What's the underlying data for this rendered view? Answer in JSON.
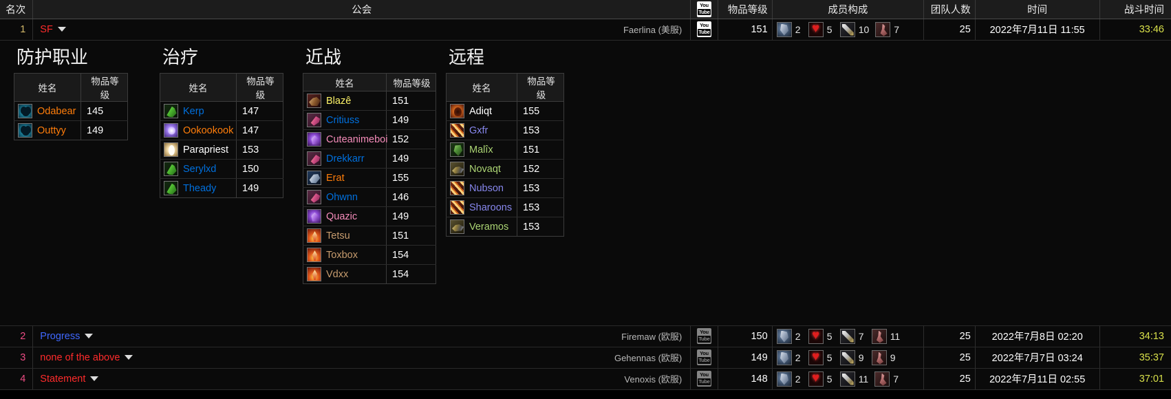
{
  "table": {
    "headers": {
      "rank": "名次",
      "guild": "公会",
      "video": "youtube-icon",
      "ilvl": "物品等级",
      "composition": "成员构成",
      "raid_size": "团队人数",
      "time": "时间",
      "duration": "战斗时间"
    }
  },
  "rows": [
    {
      "rank": "1",
      "guild": "SF",
      "guild_color": "#ff2b2b",
      "realm": "Faerlina (美服)",
      "ilvl": "151",
      "comp": {
        "tanks": "2",
        "healers": "5",
        "melee": "10",
        "ranged": "7"
      },
      "raid_size": "25",
      "time": "2022年7月11日 11:55",
      "duration": "33:46",
      "expanded": true
    },
    {
      "rank": "2",
      "guild": "Progress",
      "guild_color": "#3f68ff",
      "realm": "Firemaw (欧服)",
      "ilvl": "150",
      "comp": {
        "tanks": "2",
        "healers": "5",
        "melee": "7",
        "ranged": "11"
      },
      "raid_size": "25",
      "time": "2022年7月8日 02:20",
      "duration": "34:13",
      "expanded": false
    },
    {
      "rank": "3",
      "guild": "none of the above",
      "guild_color": "#ff2b2b",
      "realm": "Gehennas (欧服)",
      "ilvl": "149",
      "comp": {
        "tanks": "2",
        "healers": "5",
        "melee": "9",
        "ranged": "9"
      },
      "raid_size": "25",
      "time": "2022年7月7日 03:24",
      "duration": "35:37",
      "expanded": false
    },
    {
      "rank": "4",
      "guild": "Statement",
      "guild_color": "#ff2b2b",
      "realm": "Venoxis (欧服)",
      "ilvl": "148",
      "comp": {
        "tanks": "2",
        "healers": "5",
        "melee": "11",
        "ranged": "7"
      },
      "raid_size": "25",
      "time": "2022年7月11日 02:55",
      "duration": "37:01",
      "expanded": false
    }
  ],
  "roster": {
    "col_name": "姓名",
    "col_ilvl": "物品等级",
    "groups": [
      {
        "title": "防护职业",
        "players": [
          {
            "name": "Odabear",
            "ilvl": "145",
            "class": "druid",
            "icon": "bear-form-icon"
          },
          {
            "name": "Outtyy",
            "ilvl": "149",
            "class": "druid",
            "icon": "bear-form-icon"
          }
        ]
      },
      {
        "title": "治疗",
        "players": [
          {
            "name": "Kerp",
            "ilvl": "147",
            "class": "shaman",
            "icon": "restoration-shaman-icon"
          },
          {
            "name": "Ookookook",
            "ilvl": "147",
            "class": "druid",
            "icon": "restoration-druid-icon"
          },
          {
            "name": "Parapriest",
            "ilvl": "153",
            "class": "priest",
            "icon": "holy-priest-icon"
          },
          {
            "name": "Serylxd",
            "ilvl": "150",
            "class": "shaman",
            "icon": "restoration-shaman-icon"
          },
          {
            "name": "Theady",
            "ilvl": "149",
            "class": "shaman",
            "icon": "restoration-shaman-icon"
          }
        ]
      },
      {
        "title": "近战",
        "players": [
          {
            "name": "Blazê",
            "ilvl": "151",
            "class": "rogue",
            "icon": "rogue-icon"
          },
          {
            "name": "Critiuss",
            "ilvl": "149",
            "class": "shaman",
            "icon": "enhancement-shaman-icon"
          },
          {
            "name": "Cuteanimeboi",
            "ilvl": "152",
            "class": "paladin",
            "icon": "retribution-paladin-icon"
          },
          {
            "name": "Drekkarr",
            "ilvl": "149",
            "class": "shaman",
            "icon": "enhancement-shaman-icon"
          },
          {
            "name": "Erat",
            "ilvl": "155",
            "class": "druid",
            "icon": "feral-druid-icon"
          },
          {
            "name": "Ohwnn",
            "ilvl": "146",
            "class": "shaman",
            "icon": "enhancement-shaman-icon"
          },
          {
            "name": "Quazic",
            "ilvl": "149",
            "class": "paladin",
            "icon": "retribution-paladin-icon"
          },
          {
            "name": "Tetsu",
            "ilvl": "151",
            "class": "warrior",
            "icon": "warrior-icon"
          },
          {
            "name": "Toxbox",
            "ilvl": "154",
            "class": "warrior",
            "icon": "warrior-icon"
          },
          {
            "name": "Vdxx",
            "ilvl": "154",
            "class": "warrior",
            "icon": "warrior-icon"
          }
        ]
      },
      {
        "title": "远程",
        "players": [
          {
            "name": "Adiqt",
            "ilvl": "155",
            "class": "priest",
            "icon": "shadow-priest-icon"
          },
          {
            "name": "Gxfr",
            "ilvl": "153",
            "class": "warlock",
            "icon": "warlock-icon"
          },
          {
            "name": "Malîx",
            "ilvl": "151",
            "class": "hunter",
            "icon": "hunter-icon"
          },
          {
            "name": "Novaqt",
            "ilvl": "152",
            "class": "hunter",
            "icon": "marksmanship-hunter-icon"
          },
          {
            "name": "Nubson",
            "ilvl": "153",
            "class": "warlock",
            "icon": "warlock-icon"
          },
          {
            "name": "Sharoons",
            "ilvl": "153",
            "class": "warlock",
            "icon": "warlock-icon"
          },
          {
            "name": "Veramos",
            "ilvl": "153",
            "class": "hunter",
            "icon": "marksmanship-hunter-icon"
          }
        ]
      }
    ]
  }
}
